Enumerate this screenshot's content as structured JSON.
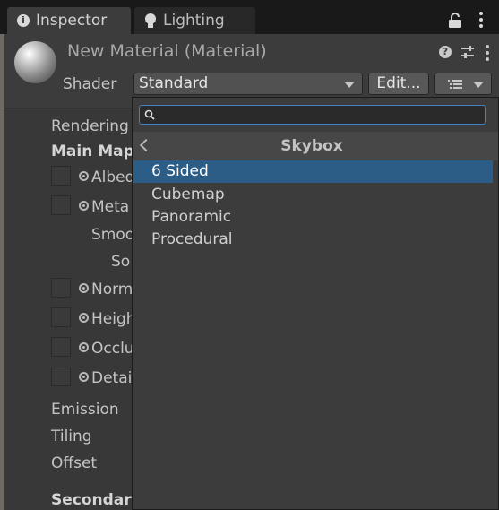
{
  "tabs": [
    {
      "label": "Inspector",
      "icon": "info-icon"
    },
    {
      "label": "Lighting",
      "icon": "lightbulb-icon"
    }
  ],
  "header": {
    "title": "New Material (Material)",
    "shader_label": "Shader",
    "shader_value": "Standard",
    "edit_label": "Edit..."
  },
  "body": {
    "rendering": "Rendering",
    "main_maps": "Main Map",
    "albedo": "Albed",
    "metallic": "Meta",
    "smoothness": "Smoo",
    "source": "So",
    "normal": "Norm",
    "height": "Heigh",
    "occlusion": "Occlu",
    "detail": "Detai",
    "emission": "Emission",
    "tiling": "Tiling",
    "offset": "Offset",
    "secondary": "Secondary"
  },
  "popup": {
    "search_value": "",
    "search_placeholder": "",
    "title": "Skybox",
    "items": [
      {
        "label": "6 Sided",
        "selected": true
      },
      {
        "label": "Cubemap",
        "selected": false
      },
      {
        "label": "Panoramic",
        "selected": false
      },
      {
        "label": "Procedural",
        "selected": false
      }
    ]
  },
  "colors": {
    "selection": "#2c5d87",
    "search_focus": "#4a7fc0",
    "panel": "#383838"
  }
}
